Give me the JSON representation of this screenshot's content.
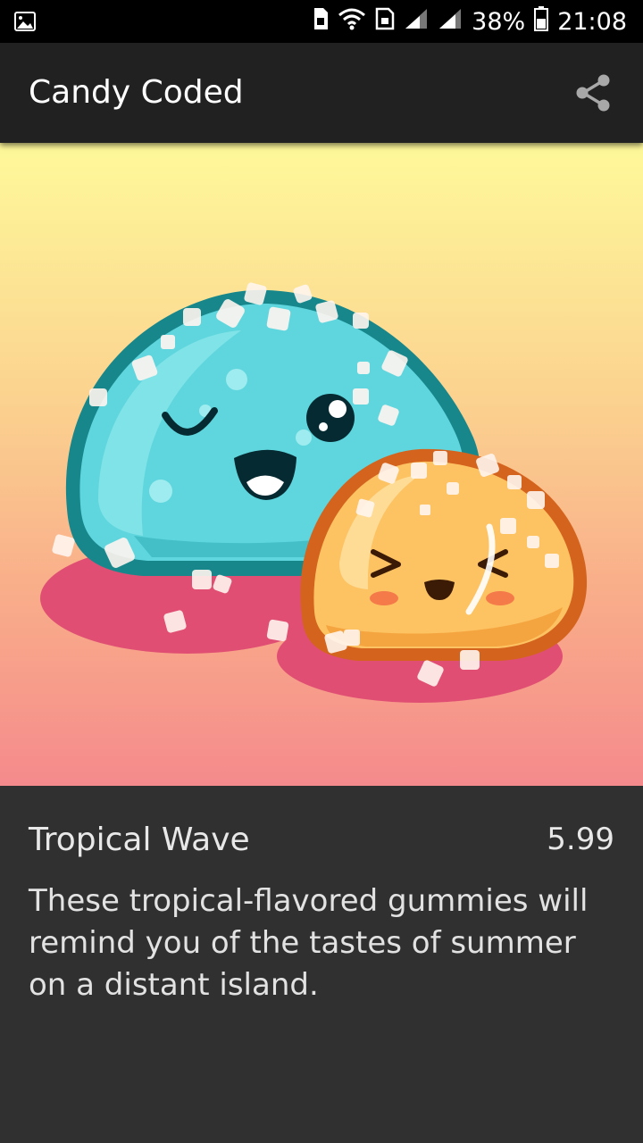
{
  "status_bar": {
    "battery": "38%",
    "time": "21:08",
    "icons": [
      "gallery-icon",
      "sim-icon",
      "wifi-icon",
      "sd-card-icon",
      "signal-icon",
      "signal-icon",
      "battery-icon"
    ]
  },
  "app_bar": {
    "title": "Candy Coded",
    "share_icon": "share-icon"
  },
  "product": {
    "name": "Tropical Wave",
    "price": "5.99",
    "description": "These tropical-flavored gummies will remind you of the tastes of summer on a distant island."
  }
}
